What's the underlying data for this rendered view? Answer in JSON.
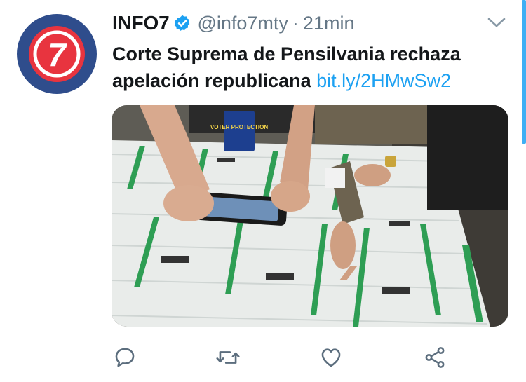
{
  "tweet": {
    "author_name": "INFO7",
    "handle": "@info7mty",
    "separator": "·",
    "time": "21min",
    "text": "Corte Suprema de Pensilvania rechaza apelación republicana",
    "link": "bit.ly/2HMwSw2",
    "avatar_logo_text": "7",
    "media_badge_text": "VOTER PROTECTION"
  },
  "icons": {
    "verified": "verified-badge-icon",
    "more": "chevron-down-icon",
    "reply": "reply-icon",
    "retweet": "retweet-icon",
    "like": "heart-icon",
    "share": "share-icon"
  },
  "colors": {
    "accent": "#1da1f2",
    "secondary_text": "#657786",
    "avatar_bg": "#2f4d8c",
    "logo_red": "#e8343f"
  }
}
